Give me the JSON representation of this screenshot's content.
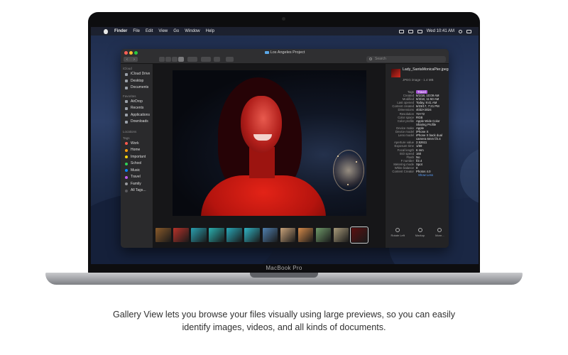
{
  "menubar": {
    "app": "Finder",
    "items": [
      "File",
      "Edit",
      "View",
      "Go",
      "Window",
      "Help"
    ],
    "clock": "Wed 10:41 AM"
  },
  "window": {
    "title": "Los Angeles Project",
    "search_placeholder": "Search"
  },
  "sidebar": {
    "sections": [
      {
        "header": "iCloud",
        "items": [
          {
            "label": "iCloud Drive",
            "icon": "cloud-icon"
          },
          {
            "label": "Desktop",
            "icon": "desktop-icon"
          },
          {
            "label": "Documents",
            "icon": "document-icon"
          }
        ]
      },
      {
        "header": "Favorites",
        "items": [
          {
            "label": "AirDrop",
            "icon": "airdrop-icon"
          },
          {
            "label": "Recents",
            "icon": "clock-icon"
          },
          {
            "label": "Applications",
            "icon": "applications-icon"
          },
          {
            "label": "Downloads",
            "icon": "download-icon"
          }
        ]
      },
      {
        "header": "Locations",
        "items": []
      },
      {
        "header": "Tags",
        "items": [
          {
            "label": "Work",
            "color": "#ff5b4f"
          },
          {
            "label": "Home",
            "color": "#ff9f0a"
          },
          {
            "label": "Important",
            "color": "#ffd60a"
          },
          {
            "label": "School",
            "color": "#30d158"
          },
          {
            "label": "Music",
            "color": "#0a84ff"
          },
          {
            "label": "Travel",
            "color": "#bf5af2"
          },
          {
            "label": "Family",
            "color": "#98989d"
          },
          {
            "label": "All Tags...",
            "color": "#5a5a5e"
          }
        ]
      }
    ]
  },
  "inspector": {
    "filename": "Lady_SantaMonicaPier.jpeg",
    "filetype": "JPEG image - 1.4 MB",
    "tag": "Travel",
    "rows": [
      {
        "k": "Created",
        "v": "6/1/18, 10:09 AM"
      },
      {
        "k": "Modified",
        "v": "6/3/18, 11:50 AM"
      },
      {
        "k": "Last opened",
        "v": "Today, 9:41 AM"
      },
      {
        "k": "Content created",
        "v": "6/23/17, 7:21 PM"
      },
      {
        "k": "Dimensions",
        "v": "4032×3024"
      },
      {
        "k": "Resolution",
        "v": "72×72"
      },
      {
        "k": "Color space",
        "v": "RGB"
      },
      {
        "k": "Color profile",
        "v": "Apple Wide Color Sharing Profile"
      },
      {
        "k": "Device make",
        "v": "Apple"
      },
      {
        "k": "Device model",
        "v": "iPhone X"
      },
      {
        "k": "Lens model",
        "v": "iPhone X back dual camera 6mm f/2.4"
      },
      {
        "k": "Aperture value",
        "v": "2.52611"
      },
      {
        "k": "Exposure time",
        "v": "1/59"
      },
      {
        "k": "Focal length",
        "v": "6 mm"
      },
      {
        "k": "ISO speed",
        "v": "160"
      },
      {
        "k": "Flash",
        "v": "No"
      },
      {
        "k": "F number",
        "v": "f/2.4"
      },
      {
        "k": "Metering mode",
        "v": "Spot"
      },
      {
        "k": "White balance",
        "v": "0"
      },
      {
        "k": "Content Creator",
        "v": "Photos 4.0"
      }
    ],
    "show_less": "Show Less",
    "actions": [
      "Rotate Left",
      "Markup",
      "More..."
    ]
  },
  "thumbnails": [
    "#8a5a2a",
    "#b8322a",
    "#2aa0b0",
    "#2ab0b0",
    "#28a8b8",
    "#30b4c4",
    "#4f7fae",
    "#c9a27a",
    "#d48a4a",
    "#6f9a6a",
    "#a89a7a",
    "#5a1010"
  ],
  "laptop_label": "MacBook Pro",
  "caption": "Gallery View lets you browse your files visually using large previews, so you can easily identify images, videos, and all kinds of documents."
}
